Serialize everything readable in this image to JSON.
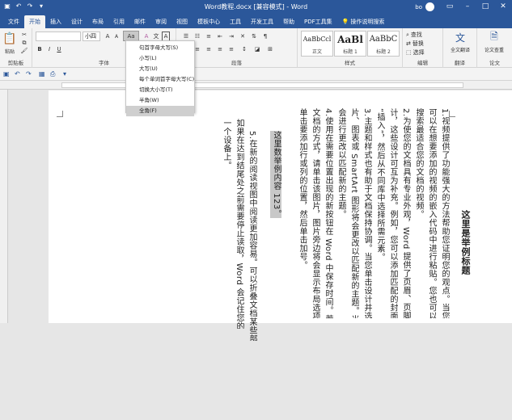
{
  "window": {
    "title": "Word教程.docx [兼容模式] - Word",
    "user": "bo"
  },
  "tabs": [
    "文件",
    "开始",
    "插入",
    "设计",
    "布局",
    "引用",
    "邮件",
    "审阅",
    "视图",
    "模板中心",
    "工具",
    "开发工具",
    "帮助",
    "PDF工具集",
    "操作说明搜索"
  ],
  "active_tab": "开始",
  "ribbon": {
    "clipboard_label": "剪贴板",
    "paste_label": "粘贴",
    "font_label": "字体",
    "font_size": "小四",
    "case_button": "Aa",
    "paragraph_label": "段落",
    "styles_label": "样式",
    "styles": [
      {
        "sample": "AaBbCcl",
        "name": "正文"
      },
      {
        "sample": "AaBl",
        "name": "标题 1"
      },
      {
        "sample": "AaBbC",
        "name": "标题 2"
      }
    ],
    "find_label": "查找",
    "replace_label": "替换",
    "select_label": "选择",
    "edit_label": "编辑",
    "translate_label": "全文翻译",
    "check_label": "论文查重",
    "translate_group": "翻译",
    "paper_group": "论文"
  },
  "case_menu": {
    "items": [
      "句首字母大写(S)",
      "小写(L)",
      "大写(U)",
      "每个单词首字母大写(C)",
      "切换大小写(T)",
      "半角(W)",
      "全角(F)"
    ],
    "selected": "全角(F)"
  },
  "document": {
    "title": "这里是举例标题",
    "col1": "1.视频提供了功能强大的方法帮助您证明您的观点。当您单击联机",
    "col2": "可以在想要添加的视频的嵌入代码中进行粘贴。您也可以键入一个关键",
    "col3": "搜索最适合您的文档的视频。",
    "col4": "2.为使您的文档具有专业外观，Word 提供了页眉、页脚、封面和",
    "col5": "计，这些设计可互为补充。例如，您可以添加匹配的封面、页眉和提要",
    "col6": "“插入”，然后从不同库中选择所需元素。",
    "col7": "3.主题和样式也有助于文档保持协调。当您单击设计并选择新的主",
    "col8": "片、图表或 SmartArt 图形将会更改以匹配新的主题。当应用样式时，",
    "col9": "会进行更改以匹配新的主题。",
    "col10": "4.使用在需要位置出现的新按钮在 Word 中保存时间。若要更改",
    "col11": "文档的方式，请单击该图片，图片旁边将会显示布局选项按钮。当处理",
    "col12": "单击要添加行或列的位置，然后单击加号。",
    "highlight": "这里数举例内容 123。",
    "col14": "5.在新的阅读视图中阅读更加容易。可以折叠文档某些部分并关注",
    "col15": "如果在达到结尾处之前需要停止读取，Word 会记住您的停止位置 -",
    "col16": "一个设备上。"
  }
}
